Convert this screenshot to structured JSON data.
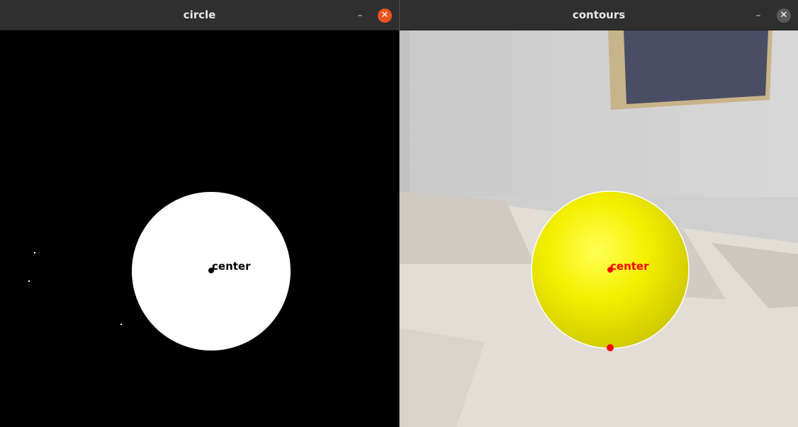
{
  "windows": {
    "left": {
      "title": "circle",
      "minimize_icon": "minimize-icon",
      "close_icon": "close-icon"
    },
    "right": {
      "title": "contours",
      "minimize_icon": "minimize-icon",
      "close_icon": "close-icon"
    }
  },
  "left_view": {
    "annotation": "center",
    "colors": {
      "background": "#000000",
      "circle": "#ffffff",
      "annotation": "#000000"
    }
  },
  "right_view": {
    "annotation": "center",
    "colors": {
      "ball": "#f2f000",
      "contour": "#ffffff",
      "annotation": "#ff0000",
      "wall": "#cfcfcf",
      "floor": "#e2ded6",
      "frame": "#c8b48a",
      "panel": "#4a4e64"
    }
  }
}
